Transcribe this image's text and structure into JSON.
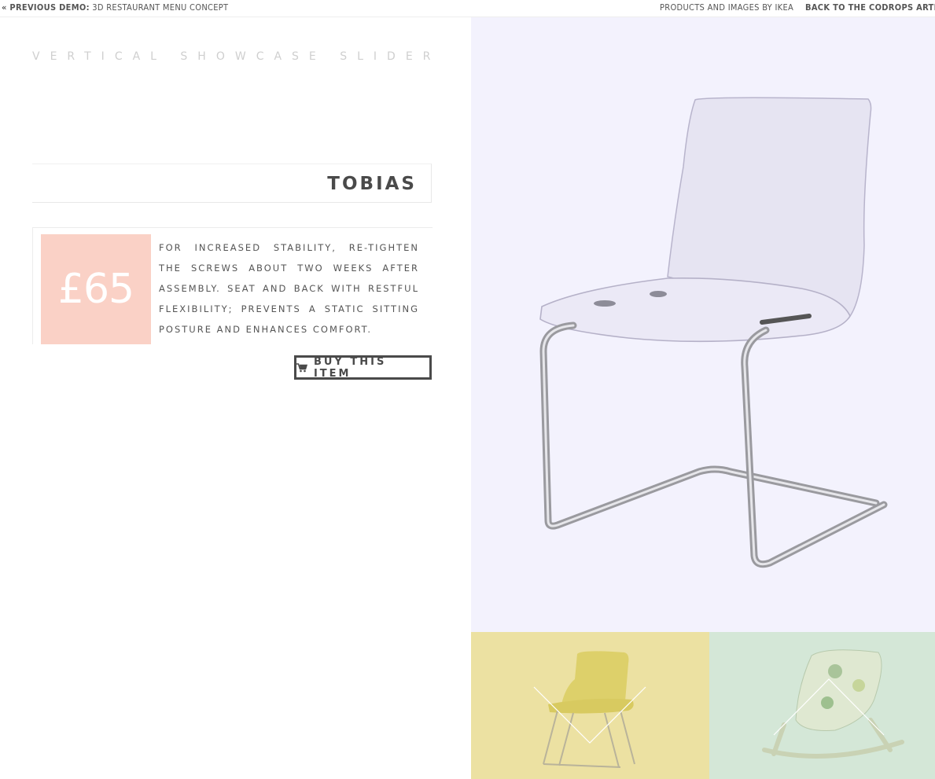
{
  "topbar": {
    "prev_label": "« PREVIOUS DEMO:",
    "prev_title": "3D RESTAURANT MENU CONCEPT",
    "credit": "PRODUCTS AND IMAGES BY IKEA",
    "back": "BACK TO THE CODROPS ARTICL"
  },
  "page": {
    "title": "VERTICAL SHOWCASE SLIDER"
  },
  "product": {
    "name": "TOBIAS",
    "price": "£65",
    "description": "For increased stability, re-tighten the screws about two weeks after assembly. Seat and back with restful flexibility; prevents a static sitting posture and enhances comfort.",
    "buy_label": "BUY THIS ITEM"
  },
  "icons": {
    "cart": "cart-icon",
    "up": "chevron-up-icon",
    "down": "chevron-down-icon"
  },
  "colors": {
    "price_bg": "#fad1c6",
    "hero_bg": "#f3f2fd",
    "thumb_yellow_bg": "#ece1a2",
    "thumb_green_bg": "#d4e7d7"
  }
}
